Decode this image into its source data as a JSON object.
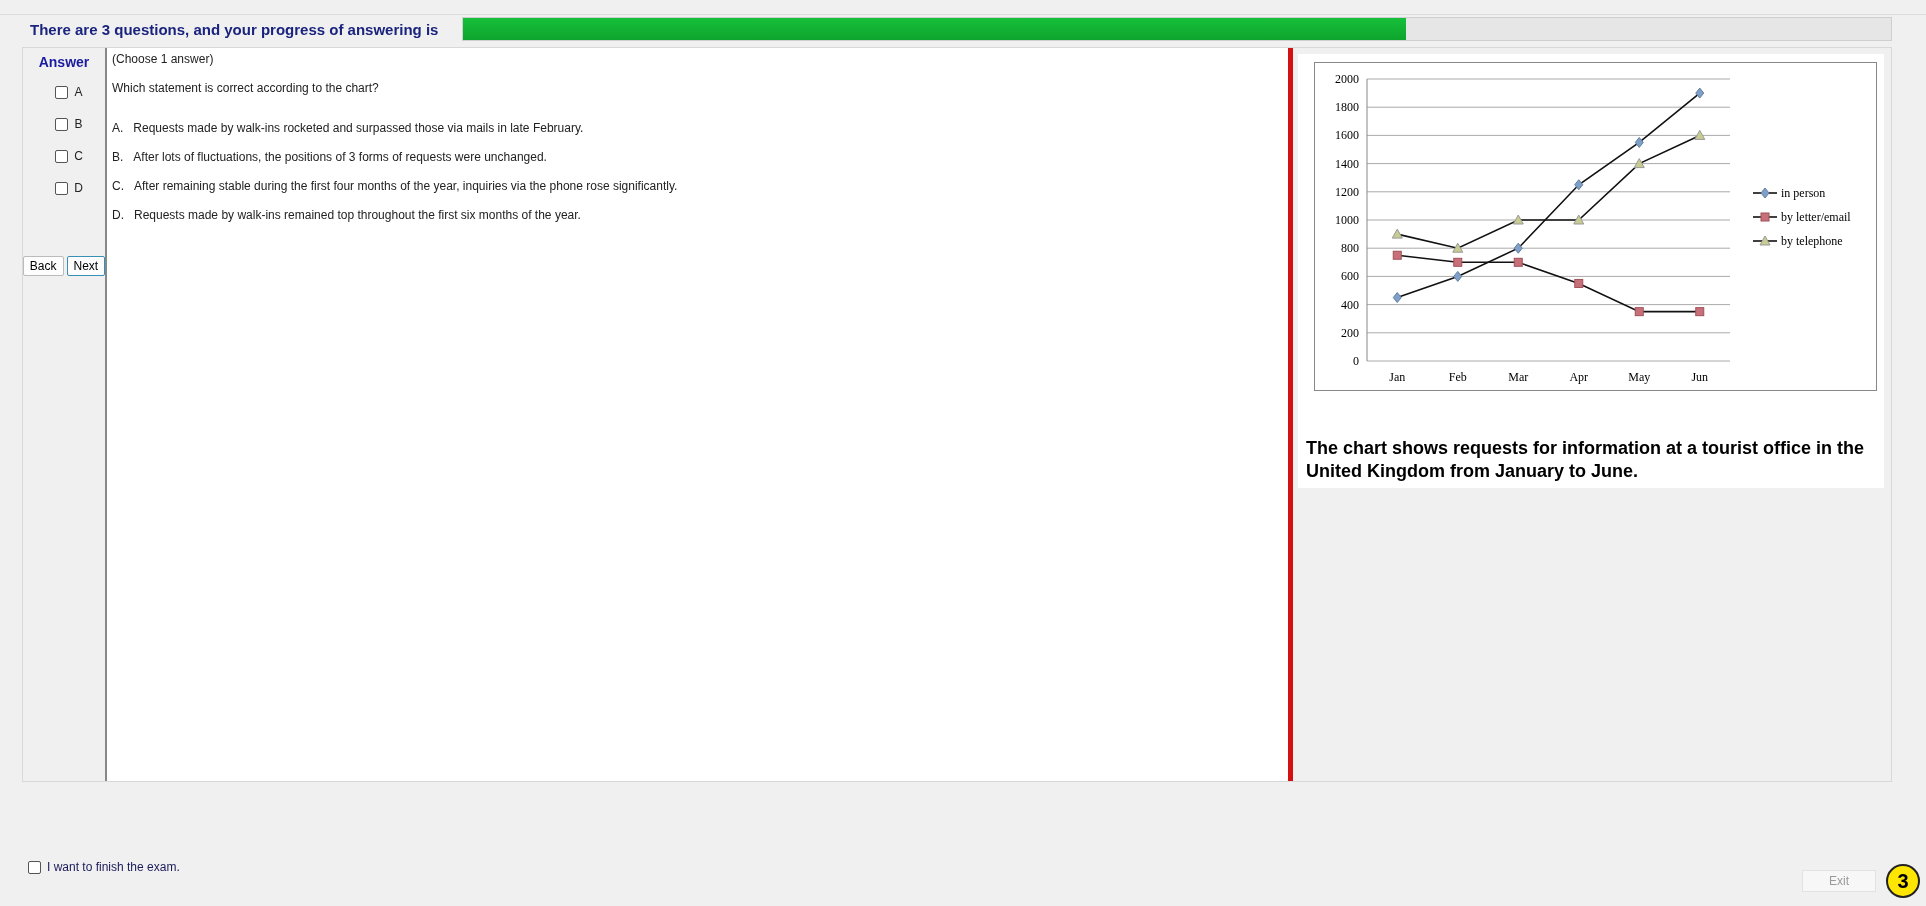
{
  "header": {
    "progress_text": "There are 3 questions, and your progress of answering is",
    "progress": {
      "level": 0.66
    }
  },
  "answer_panel": {
    "title": "Answer",
    "options": [
      {
        "label": "A",
        "checked": false
      },
      {
        "label": "B",
        "checked": false
      },
      {
        "label": "C",
        "checked": false
      },
      {
        "label": "D",
        "checked": false
      }
    ],
    "buttons": [
      "Back",
      "Next"
    ]
  },
  "question": {
    "instruction": "(Choose 1 answer)",
    "prompt": "Which statement is correct according to the chart?",
    "choices": [
      {
        "letter": "A.",
        "text": "Requests made by walk-ins rocketed and surpassed those via mails in late February."
      },
      {
        "letter": "B.",
        "text": "After lots of fluctuations, the positions of 3 forms of requests were unchanged."
      },
      {
        "letter": "C.",
        "text": "After remaining stable during the first four months of the year, inquiries via the phone rose significantly."
      },
      {
        "letter": "D.",
        "text": "Requests made by walk-ins remained top throughout the first six months of the year."
      }
    ]
  },
  "figure": {
    "chart_data": {
      "type": "line",
      "grid": true,
      "legend": true,
      "categories": [
        "Jan",
        "Feb",
        "Mar",
        "Apr",
        "May",
        "Jun"
      ],
      "ylim": [
        0,
        2000
      ],
      "yticks": [
        0,
        200,
        400,
        600,
        800,
        1000,
        1200,
        1400,
        1600,
        1800,
        2000
      ],
      "series": [
        {
          "name": "in person",
          "color": "#7f9fc8",
          "marker": "diamond",
          "values": [
            450,
            600,
            800,
            1250,
            1550,
            1900
          ]
        },
        {
          "name": "by letter/email",
          "color": "#c8707a",
          "marker": "square",
          "values": [
            750,
            700,
            700,
            550,
            350,
            350
          ]
        },
        {
          "name": "by telephone",
          "color": "#c8cc90",
          "marker": "triangle",
          "values": [
            900,
            800,
            1000,
            1000,
            1400,
            1600
          ]
        }
      ]
    },
    "caption": "The chart shows requests for information at a tourist office in the United Kingdom from January to June."
  },
  "footer": {
    "finish_checkbox": {
      "label": "I want to finish the exam.",
      "checked": false
    },
    "exit_button": "Exit",
    "badge": "3"
  }
}
